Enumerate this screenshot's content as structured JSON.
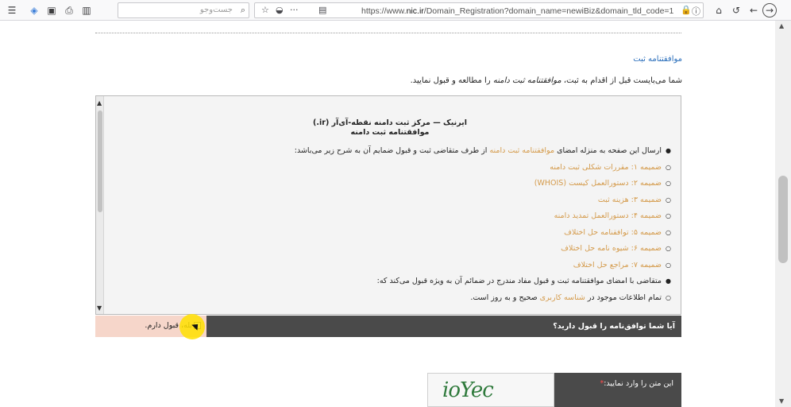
{
  "browser": {
    "search_placeholder": "جست‌وجو",
    "url_prefix": "https://www.",
    "url_domain": "nic.ir",
    "url_rest": "/Domain_Registration?domain_name=newiBiz&domain_tld_code=1",
    "icons": [
      "menu-icon",
      "extension-icon",
      "sidebar-icon",
      "print-icon",
      "library-icon",
      "search-icon",
      "bookmark-star-icon",
      "pocket-icon",
      "more-icon",
      "reader-icon",
      "lock-icon",
      "info-icon",
      "home-icon",
      "undo-icon",
      "back-icon",
      "forward-icon"
    ]
  },
  "page": {
    "section_title": "موافقتنامه ثبت",
    "intro_before": "شما می‌بایست قبل از اقدام به ثبت، ",
    "intro_em": "موافقتنامه ثبت دامنه",
    "intro_after": " را مطالعه و قبول نمایید.",
    "doc_title_1": "ایرنیک — مرکز ثبت دامنه نقطه-آی‌آر (ir.)",
    "doc_title_2": "موافقتنامه ثبت دامنه",
    "items": [
      {
        "type": "main",
        "before": "ارسال این صفحه به منزله امضای ",
        "link": "موافقتنامه ثبت دامنه",
        "after": " از طرف متقاضی ثبت و قبول ضمایم آن به شرح زیر می‌باشد:"
      },
      {
        "type": "sub",
        "text": "ضمیمه ۱: مقررات شکلی ثبت دامنه"
      },
      {
        "type": "sub",
        "text": "ضمیمه ۲: دستورالعمل کیست (WHOIS)"
      },
      {
        "type": "sub",
        "text": "ضمیمه ۳: هزینه ثبت"
      },
      {
        "type": "sub",
        "text": "ضمیمه ۴: دستورالعمل تمدید دامنه"
      },
      {
        "type": "sub",
        "text": "ضمیمه ۵: توافقنامه حل اختلاف"
      },
      {
        "type": "sub",
        "text": "ضمیمه ۶: شیوه نامه حل اختلاف"
      },
      {
        "type": "sub",
        "text": "ضمیمه ۷: مراجع حل اختلاف"
      },
      {
        "type": "main",
        "before": "متقاضی با امضای موافقتنامه ثبت و قبول مفاد مندرج در ضمائم آن به ویژه قبول می‌کند که:",
        "link": "",
        "after": ""
      },
      {
        "type": "main-sub",
        "before": "تمام اطلاعات موجود در ",
        "link": "شناسه کاربری",
        "after": " صحیح و به روز است."
      }
    ],
    "question": "آیا شما توافق‌نامه را قبول دارید؟",
    "answer": "بله، قبول دارم.",
    "captcha_label": "این متن را وارد نمایید:",
    "captcha_required": "*",
    "captcha_text": "ioYec"
  }
}
